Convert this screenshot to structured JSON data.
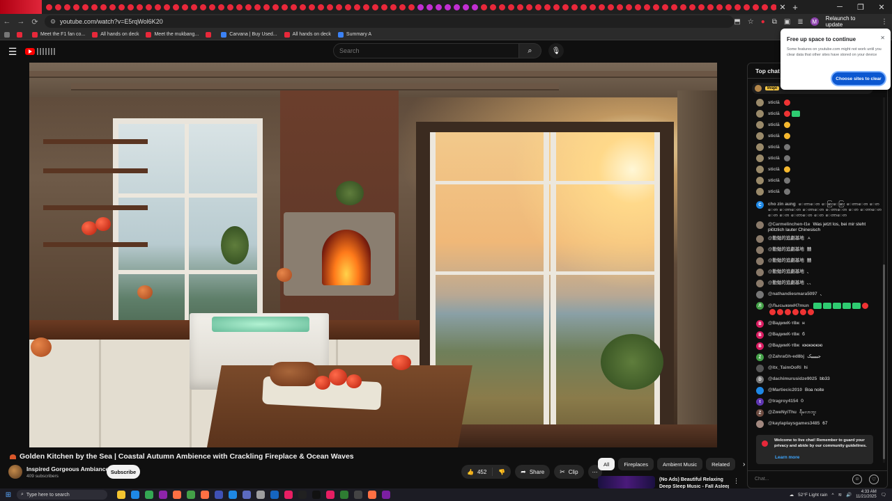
{
  "browser": {
    "url": "youtube.com/watch?v=E5rqWol6K20",
    "relaunch_label": "Relaunch to update",
    "profile_initial": "M",
    "bookmarks": [
      {
        "label": ""
      },
      {
        "label": "Meet the F1 fan co..."
      },
      {
        "label": "All hands on deck"
      },
      {
        "label": "Meet the mukbang..."
      },
      {
        "label": ""
      },
      {
        "label": "Carvana | Buy Used..."
      },
      {
        "label": "All hands on deck"
      },
      {
        "label": "Summary A"
      }
    ]
  },
  "popup": {
    "title": "Free up space to continue",
    "body": "Some features on youtube.com might not work until you clear data that other sites have stored on your device",
    "button_label": "Choose sites to clear",
    "close_glyph": "✕"
  },
  "header": {
    "search_placeholder": "Search"
  },
  "video": {
    "title": "Golden Kitchen by the Sea | Coastal Autumn Ambience with Crackling Fireplace & Ocean Waves",
    "channel": "Inspired Gorgeous Ambiance",
    "subscribers": "409 subscribers",
    "subscribe_label": "Subscribe",
    "likes": "452",
    "share_label": "Share",
    "clip_label": "Clip"
  },
  "related": {
    "chips": [
      "All",
      "Fireplaces",
      "Ambient Music",
      "Related"
    ],
    "first_title": "(No Ads) Beautiful Relaxing",
    "first_title_line2": "Deep Sleep Music - Fall Asleep"
  },
  "chat": {
    "header_label": "Top chat",
    "header_chevron": "▾",
    "pinned_name": "Inspi",
    "messages": [
      {
        "author": "sticlă",
        "text": "",
        "emoji": "red",
        "color": "#9a8a6a"
      },
      {
        "author": "sticlă",
        "text": "",
        "emoji": "red-green",
        "color": "#9a8a6a"
      },
      {
        "author": "sticlă",
        "text": "",
        "emoji": "yel",
        "color": "#9a8a6a"
      },
      {
        "author": "sticlă",
        "text": "",
        "emoji": "yel",
        "color": "#9a8a6a"
      },
      {
        "author": "sticlă",
        "text": "",
        "emoji": "grey",
        "color": "#9a8a6a"
      },
      {
        "author": "sticlă",
        "text": "",
        "emoji": "grey",
        "color": "#9a8a6a"
      },
      {
        "author": "sticlă",
        "text": "",
        "emoji": "yel",
        "color": "#9a8a6a"
      },
      {
        "author": "sticlă",
        "text": "",
        "emoji": "grey",
        "color": "#9a8a6a"
      },
      {
        "author": "sticlă",
        "text": "",
        "emoji": "grey",
        "color": "#9a8a6a"
      },
      {
        "author": "cho zin aung",
        "text": "ေတာေတ ေဆြးေဆြး ေတာေတ ေတ ေတ ေတာေတ ေတာေတ ေတာေတ ေတ ေတာေတ ေတ ေတ ေတာေတ ေတ ေတာေတ",
        "emoji": "",
        "color": "#1e88e5",
        "initial": "C"
      },
      {
        "author": "@Carmelinchen-l1e",
        "text": "Was jetzt los, bei mir steht plötzlich lauter Chinesisch",
        "emoji": "",
        "color": "#8a7a6a"
      },
      {
        "author": "@勤勉的追劇基地",
        "text": "ㅅ",
        "emoji": "",
        "color": "#8a7a6a"
      },
      {
        "author": "@勤勉的追劇基地",
        "text": "囍",
        "emoji": "",
        "color": "#8a7a6a"
      },
      {
        "author": "@勤勉的追劇基地",
        "text": "囍",
        "emoji": "",
        "color": "#8a7a6a"
      },
      {
        "author": "@勤勉的追劇基地",
        "text": "、",
        "emoji": "",
        "color": "#8a7a6a"
      },
      {
        "author": "@勤勉的追劇基地",
        "text": "、、",
        "emoji": "",
        "color": "#8a7a6a"
      },
      {
        "author": "@nathandiesmara5097",
        "text": "、",
        "emoji": "",
        "color": "#777777"
      },
      {
        "author": "@ЛысыкинН7mun",
        "text": "",
        "emoji": "green-row",
        "color": "#43a047",
        "initial": "Л"
      },
      {
        "author": "@ВадимК-т8ж",
        "text": "н",
        "emoji": "",
        "color": "#d81b60",
        "initial": "B"
      },
      {
        "author": "@ВадимК-т8ж",
        "text": "б",
        "emoji": "",
        "color": "#d81b60",
        "initial": "B"
      },
      {
        "author": "@ВадимК-т8ж",
        "text": "юююююю",
        "emoji": "",
        "color": "#d81b60",
        "initial": "B"
      },
      {
        "author": "@ZahraGh-ed8bj",
        "text": "جیییییک",
        "emoji": "",
        "color": "#43a047",
        "initial": "Z"
      },
      {
        "author": "@itx_TaimOoRi",
        "text": "hi",
        "emoji": "",
        "color": "#555555"
      },
      {
        "author": "@dachimurusidze9025",
        "text": "bb33",
        "emoji": "",
        "color": "#777777",
        "initial": "D"
      },
      {
        "author": "@Martiecic2010",
        "text": "Boa noite",
        "emoji": "",
        "color": "#1e88e5"
      },
      {
        "author": "@tragroy4154",
        "text": "0",
        "emoji": "",
        "color": "#5e35b1",
        "initial": "t"
      },
      {
        "author": "@ZweNyiThu",
        "text": "ရီမလာဘူး",
        "emoji": "",
        "color": "#6d4c41",
        "initial": "Z"
      },
      {
        "author": "@kaylaplaysgames3485",
        "text": "67",
        "emoji": "",
        "color": "#a1887f"
      }
    ],
    "welcome_text": "Welcome to live chat! Remember to guard your privacy and abide by our community guidelines.",
    "learn_more": "Learn more",
    "input_placeholder": "Chat..."
  },
  "taskbar": {
    "search_placeholder": "Type here to search",
    "weather": "52°F  Light rain",
    "time": "4:33 AM",
    "date": "11/21/2025"
  }
}
